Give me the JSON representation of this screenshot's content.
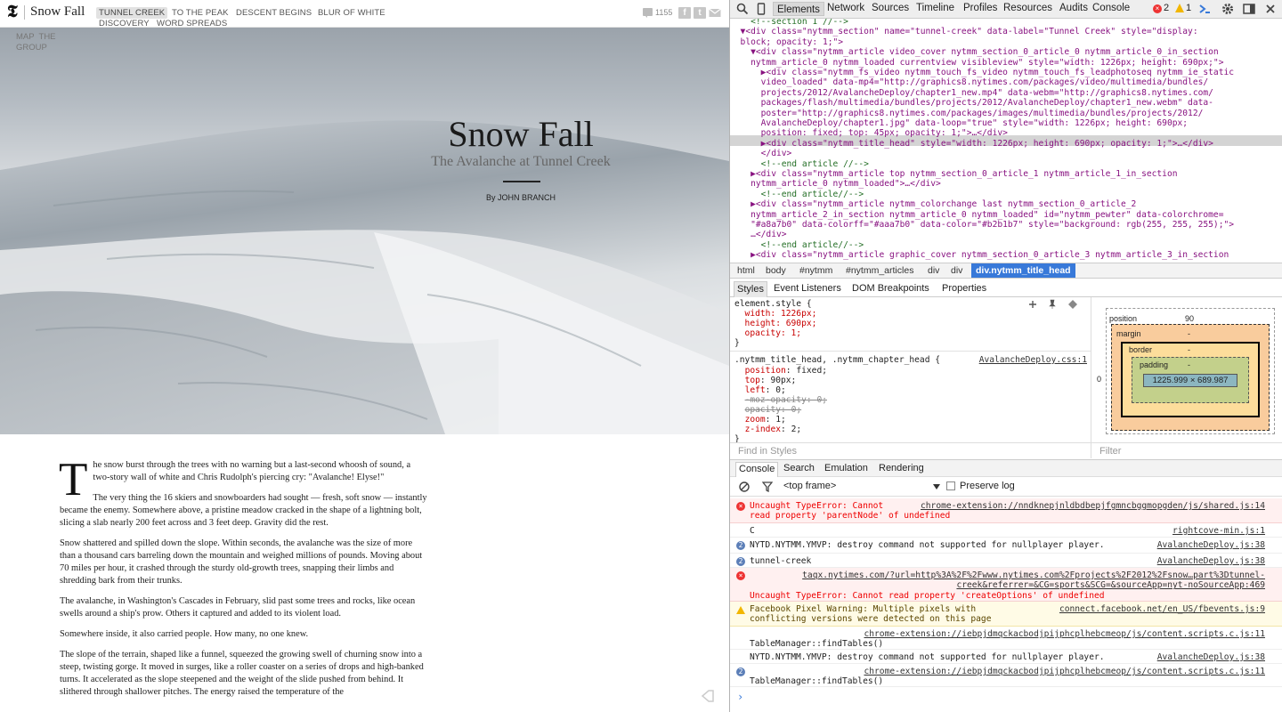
{
  "page": {
    "logo": "𝕿",
    "site_title": "Snow Fall",
    "chapters": [
      "TUNNEL CREEK",
      "TO THE PEAK",
      "DESCENT BEGINS",
      "BLUR OF WHITE",
      "DISCOVERY",
      "WORD SPREADS"
    ],
    "comment_count": "1155",
    "map_link": "MAP  THE\nGROUP",
    "hero": {
      "title": "Snow Fall",
      "subtitle": "The Avalanche at Tunnel Creek",
      "byline": "By JOHN BRANCH"
    },
    "article": {
      "dropcap": "T",
      "p1": "he snow burst through the trees with no warning but a last-second whoosh of sound, a two-story wall of white and Chris Rudolph's piercing cry: \"Avalanche! Elyse!\"",
      "p2": "The very thing the 16 skiers and snowboarders had sought — fresh, soft snow — instantly became the enemy. Somewhere above, a pristine meadow cracked in the shape of a lightning bolt, slicing a slab nearly 200 feet across and 3 feet deep. Gravity did the rest.",
      "p3": "Snow shattered and spilled down the slope. Within seconds, the avalanche was the size of more than a thousand cars barreling down the mountain and weighed millions of pounds. Moving about 70 miles per hour, it crashed through the sturdy old-growth trees, snapping their limbs and shredding bark from their trunks.",
      "p4": "The avalanche, in Washington's Cascades in February, slid past some trees and rocks, like ocean swells around a ship's prow. Others it captured and added to its violent load.",
      "p5": "Somewhere inside, it also carried people. How many, no one knew.",
      "p6": "The slope of the terrain, shaped like a funnel, squeezed the growing swell of churning snow into a steep, twisting gorge. It moved in surges, like a roller coaster on a series of drops and high-banked turns. It accelerated as the slope steepened and the weight of the slide pushed from behind. It slithered through shallower pitches. The energy raised the temperature of the"
    }
  },
  "devtools": {
    "tabs": [
      "Elements",
      "Network",
      "Sources",
      "Timeline",
      "Profiles",
      "Resources",
      "Audits",
      "Console"
    ],
    "error_count": "2",
    "warning_count": "1",
    "dom_lines": [
      "    <!--section 1 //-->",
      "  ▼<div class=\"nytmm_section\" name=\"tunnel-creek\" data-label=\"Tunnel Creek\" style=\"display:",
      "  block; opacity: 1;\">",
      "    ▼<div class=\"nytmm_article video_cover nytmm_section_0_article_0 nytmm_article_0_in_section",
      "    nytmm_article_0 nytmm_loaded currentview visibleview\" style=\"width: 1226px; height: 690px;\">",
      "      ▶<div class=\"nytmm_fs_video nytmm_touch_fs_video nytmm_touch_fs_leadphotoseq nytmm_ie_static",
      "      video_loaded\" data-mp4=\"http://graphics8.nytimes.com/packages/video/multimedia/bundles/",
      "      projects/2012/AvalancheDeploy/chapter1_new.mp4\" data-webm=\"http://graphics8.nytimes.com/",
      "      packages/flash/multimedia/bundles/projects/2012/AvalancheDeploy/chapter1_new.webm\" data-",
      "      poster=\"http://graphics8.nytimes.com/packages/images/multimedia/bundles/projects/2012/",
      "      AvalancheDeploy/chapter1.jpg\" data-loop=\"true\" style=\"width: 1226px; height: 690px;",
      "      position: fixed; top: 45px; opacity: 1;\">…</div>",
      "      ▶<div class=\"nytmm_title_head\" style=\"width: 1226px; height: 690px; opacity: 1;\">…</div>",
      "      </div>",
      "      <!--end article //-->",
      "    ▶<div class=\"nytmm_article top nytmm_section_0_article_1 nytmm_article_1_in_section",
      "    nytmm_article_0 nytmm_loaded\">…</div>",
      "      <!--end article//-->",
      "    ▶<div class=\"nytmm_article nytmm_colorchange last nytmm_section_0_article_2",
      "    nytmm_article_2_in_section nytmm_article_0 nytmm_loaded\" id=\"nytmm_pewter\" data-colorchrome=",
      "    \"#a8a7b0\" data-colorff=\"#aaa7b0\" data-color=\"#b2b1b7\" style=\"background: rgb(255, 255, 255);\">",
      "    …</div>",
      "      <!--end article//-->",
      "    ▶<div class=\"nytmm_article graphic_cover nytmm_section_0_article_3 nytmm_article_3_in_section"
    ],
    "breadcrumbs": [
      "html",
      "body",
      "#nytmm",
      "#nytmm_articles",
      "div",
      "div",
      "div.nytmm_title_head"
    ],
    "subtabs": [
      "Styles",
      "Event Listeners",
      "DOM Breakpoints",
      "Properties"
    ],
    "styles": {
      "element_style": [
        "element.style {",
        "  width: 1226px;",
        "  height: 690px;",
        "  opacity: 1;",
        "}"
      ],
      "rule_selector": ".nytmm_title_head, .nytmm_chapter_head {",
      "rule_source": "AvalancheDeploy.css:1",
      "rule_props": [
        {
          "name": "position",
          "value": "fixed;",
          "struck": false
        },
        {
          "name": "top",
          "value": "90px;",
          "struck": false
        },
        {
          "name": "left",
          "value": "0;",
          "struck": false
        },
        {
          "name": "-moz-opacity",
          "value": "0;",
          "struck": true
        },
        {
          "name": "opacity",
          "value": "0;",
          "struck": true
        },
        {
          "name": "zoom",
          "value": "1;",
          "struck": false
        },
        {
          "name": "z-index",
          "value": "2;",
          "struck": false
        }
      ],
      "rule_close": "}",
      "find_placeholder": "Find in Styles",
      "filter_placeholder": "Filter"
    },
    "box_model": {
      "position_label": "position",
      "position_top": "90",
      "position_left": "0",
      "margin_label": "margin",
      "border_label": "border",
      "padding_label": "padding",
      "content": "1225.999 × 689.987",
      "dash": "-"
    },
    "console_tabs": [
      "Console",
      "Search",
      "Emulation",
      "Rendering"
    ],
    "frame": "<top frame>",
    "preserve_log": "Preserve log",
    "messages": [
      {
        "level": "error",
        "text": "Uncaught TypeError: Cannot\nread property 'parentNode' of undefined",
        "source": "chrome-extension://nndknepjnldbdbepjfgmncbggmopgden/js/shared.js:14"
      },
      {
        "level": "log",
        "text": "C",
        "source": "rightcove-min.js:1"
      },
      {
        "level": "count",
        "count": "2",
        "text": "NYTD.NYTMM.YMVP: destroy command not supported for nullplayer player.",
        "source": "AvalancheDeploy.js:38"
      },
      {
        "level": "count",
        "count": "2",
        "text": "tunnel-creek",
        "source": "AvalancheDeploy.js:38"
      },
      {
        "level": "error",
        "text": "\n\nUncaught TypeError: Cannot read property 'createOptions' of undefined",
        "source": "taqx.nytimes.com/?url=http%3A%2F%2Fwww.nytimes.com%2Fprojects%2F2012%2Fsnow…part%3Dtunnel-\ncreek&referrer=&CG=sports&SCG=&sourceApp=nyt-noSourceApp:469"
      },
      {
        "level": "warning",
        "text": "Facebook Pixel Warning: Multiple pixels with\nconflicting versions were detected on this page",
        "source": "connect.facebook.net/en_US/fbevents.js:9"
      },
      {
        "level": "log",
        "text": "\nTableManager::findTables()",
        "source": "chrome-extension://iebpjdmqckacbodjpijphcplhebcmeop/js/content.scripts.c.js:11"
      },
      {
        "level": "log",
        "text": "NYTD.NYTMM.YMVP: destroy command not supported for nullplayer player.",
        "source": "AvalancheDeploy.js:38"
      },
      {
        "level": "count",
        "count": "2",
        "text": "\nTableManager::findTables()",
        "source": "chrome-extension://iebpjdmqckacbodjpijphcplhebcmeop/js/content.scripts.c.js:11"
      }
    ],
    "prompt": "›"
  }
}
